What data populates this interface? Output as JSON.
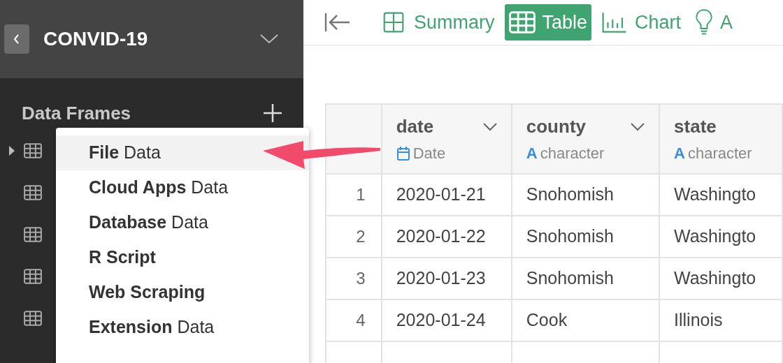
{
  "project": {
    "title": "CONVID-19"
  },
  "sidebar": {
    "section_title": "Data Frames",
    "items": [
      {
        "expandable": true
      },
      {
        "expandable": false
      },
      {
        "expandable": false
      },
      {
        "expandable": false
      },
      {
        "expandable": false
      }
    ]
  },
  "toolbar": {
    "tabs": [
      {
        "label": "Summary",
        "kind": "summary",
        "selected": false
      },
      {
        "label": "Table",
        "kind": "table",
        "selected": true
      },
      {
        "label": "Chart",
        "kind": "chart",
        "selected": false
      },
      {
        "label": "A",
        "kind": "insight",
        "selected": false
      }
    ]
  },
  "table": {
    "columns": [
      {
        "name": "date",
        "type": "Date",
        "kind": "date"
      },
      {
        "name": "county",
        "type": "character",
        "kind": "character",
        "icon": "A"
      },
      {
        "name": "state",
        "type": "character",
        "kind": "character",
        "icon": "A"
      }
    ],
    "rows": [
      {
        "index": "1",
        "cells": [
          "2020-01-21",
          "Snohomish",
          "Washingto"
        ]
      },
      {
        "index": "2",
        "cells": [
          "2020-01-22",
          "Snohomish",
          "Washingto"
        ]
      },
      {
        "index": "3",
        "cells": [
          "2020-01-23",
          "Snohomish",
          "Washingto"
        ]
      },
      {
        "index": "4",
        "cells": [
          "2020-01-24",
          "Cook",
          "Illinois"
        ]
      }
    ]
  },
  "import_menu": {
    "items": [
      {
        "bold": "File",
        "rest": "Data",
        "selected": true
      },
      {
        "bold": "Cloud Apps",
        "rest": "Data",
        "selected": false
      },
      {
        "bold": "Database",
        "rest": "Data",
        "selected": false
      },
      {
        "bold": "R Script",
        "selected": false
      },
      {
        "bold": "Web Scraping",
        "selected": false
      },
      {
        "bold": "Extension",
        "rest": "Data",
        "selected": false
      }
    ]
  }
}
